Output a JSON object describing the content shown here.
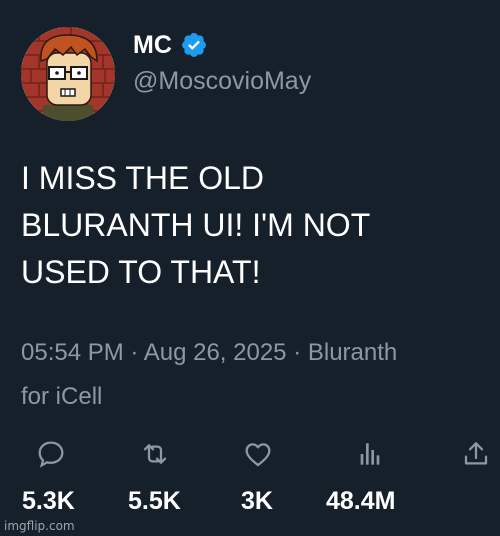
{
  "author": {
    "display_name": "MC",
    "handle": "@MoscovioMay",
    "verified": true,
    "avatar": "cartoon-avatar-glasses-red-hair"
  },
  "tweet": {
    "text_lines": [
      "I MISS THE OLD",
      "BLURANTH UI! I'M NOT",
      "USED TO THAT!"
    ],
    "meta_line1": "05:54 PM · Aug 26, 2025 · Bluranth",
    "meta_line2": "for iCell"
  },
  "actions": {
    "icons": [
      "reply-icon",
      "retweet-icon",
      "like-icon",
      "views-icon",
      "share-icon"
    ]
  },
  "stats": {
    "replies": "5.3K",
    "retweets": "5.5K",
    "likes": "3K",
    "views": "48.4M"
  },
  "watermark": "imgflip.com",
  "colors": {
    "background": "#16202a",
    "text": "#ffffff",
    "muted": "#8b98a5",
    "verified": "#1d9bf0"
  }
}
